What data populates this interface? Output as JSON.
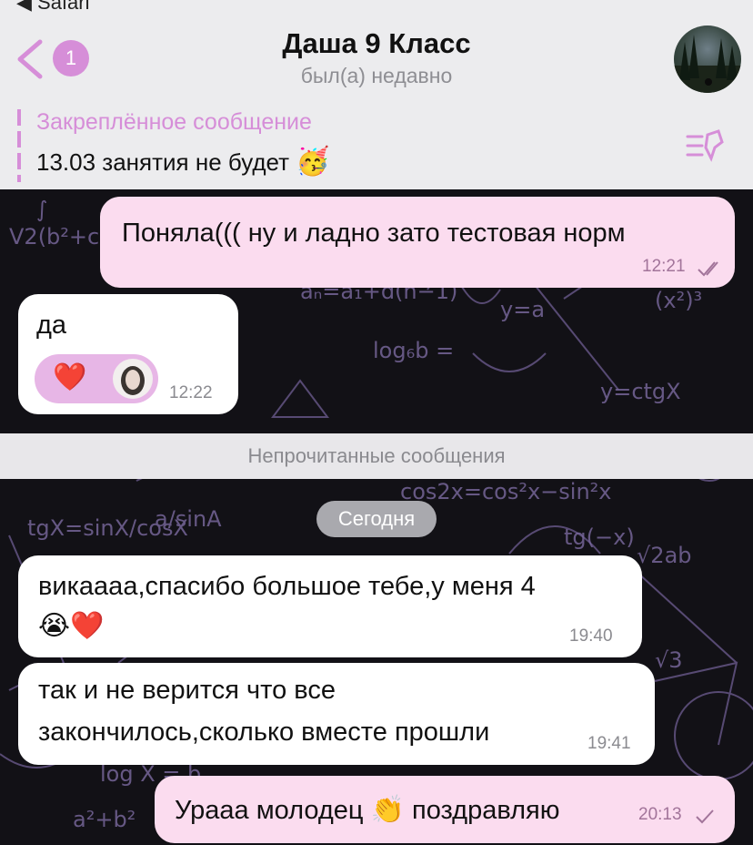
{
  "status_bar": {
    "back_app": "◀ Safari"
  },
  "header": {
    "unread_count": "1",
    "title": "Даша 9 Класс",
    "subtitle": "был(а) недавно"
  },
  "pinned": {
    "label": "Закреплённое сообщение",
    "text": "13.03 занятия не будет",
    "emoji": "🥳"
  },
  "messages": [
    {
      "direction": "out",
      "text": "Поняла((( ну и ладно зато тестовая норм",
      "time": "12:21",
      "status": "read"
    },
    {
      "direction": "in",
      "text": "да",
      "time": "12:22",
      "reaction": "❤️"
    },
    {
      "direction": "in",
      "lines": [
        "викаааа,спасибо большое тебе,у меня 4",
        "😭❤️"
      ],
      "time": "19:40"
    },
    {
      "direction": "in",
      "lines": [
        "так и не верится что все",
        "закончилось,сколько вместе прошли"
      ],
      "time": "19:41"
    },
    {
      "direction": "out",
      "text_before": "Урааа молодец ",
      "emoji": "👏",
      "text_after": " поздравляю",
      "time": "20:13",
      "status": "sent"
    }
  ],
  "unread_divider": "Непрочитанные сообщения",
  "date_label": "Сегодня",
  "colors": {
    "accent": "#d68ed8",
    "outgoing_bubble": "#fbdcef",
    "incoming_bubble": "#ffffff",
    "chat_background": "#121116",
    "header_background": "#ececee"
  },
  "icons": {
    "back": "chevron-left-icon",
    "pinned_list": "pin-list-icon",
    "read_status": "double-check-icon",
    "sent_status": "single-check-icon"
  }
}
